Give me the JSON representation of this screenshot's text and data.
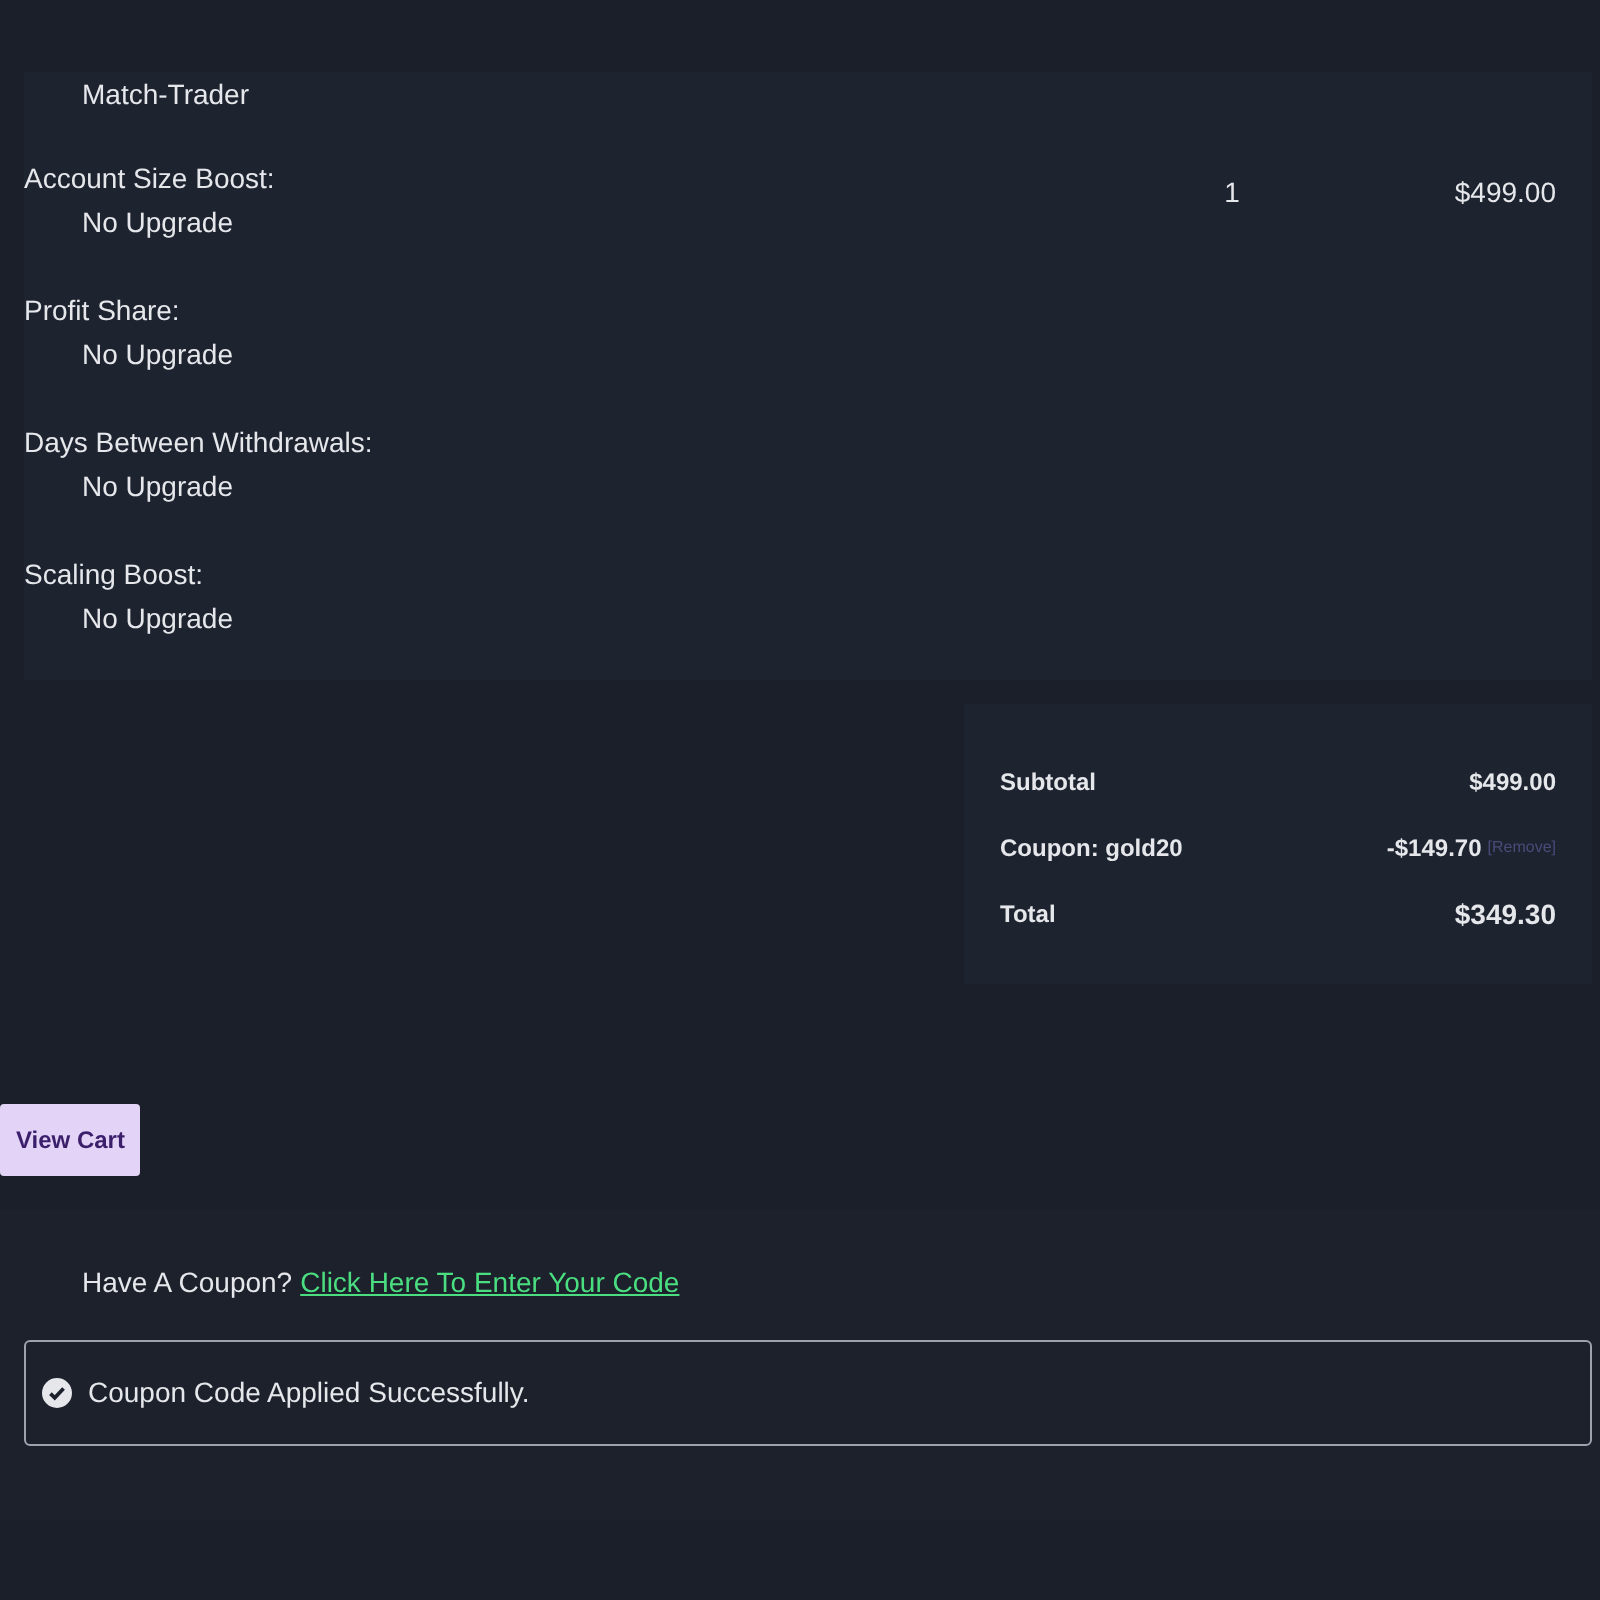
{
  "item": {
    "name": "Match-Trader",
    "quantity": "1",
    "price": "$499.00",
    "options": [
      {
        "label": "Account Size Boost:",
        "value": "No Upgrade"
      },
      {
        "label": "Profit Share:",
        "value": "No Upgrade"
      },
      {
        "label": "Days Between Withdrawals:",
        "value": "No Upgrade"
      },
      {
        "label": "Scaling Boost:",
        "value": "No Upgrade"
      }
    ]
  },
  "totals": [
    {
      "kind": "plain",
      "label": "Subtotal",
      "value": "$499.00"
    },
    {
      "kind": "coupon",
      "label": "Coupon: gold20",
      "value": "-$149.70",
      "action": "[Remove]"
    },
    {
      "kind": "total",
      "label": "Total",
      "value": "$349.30"
    }
  ],
  "view_cart_button": "View Cart",
  "coupon_prompt": {
    "text": "Have A Coupon?",
    "link": "Click Here To Enter Your Code"
  },
  "notice": {
    "kind": "success",
    "message": "Coupon Code Applied Successfully."
  }
}
